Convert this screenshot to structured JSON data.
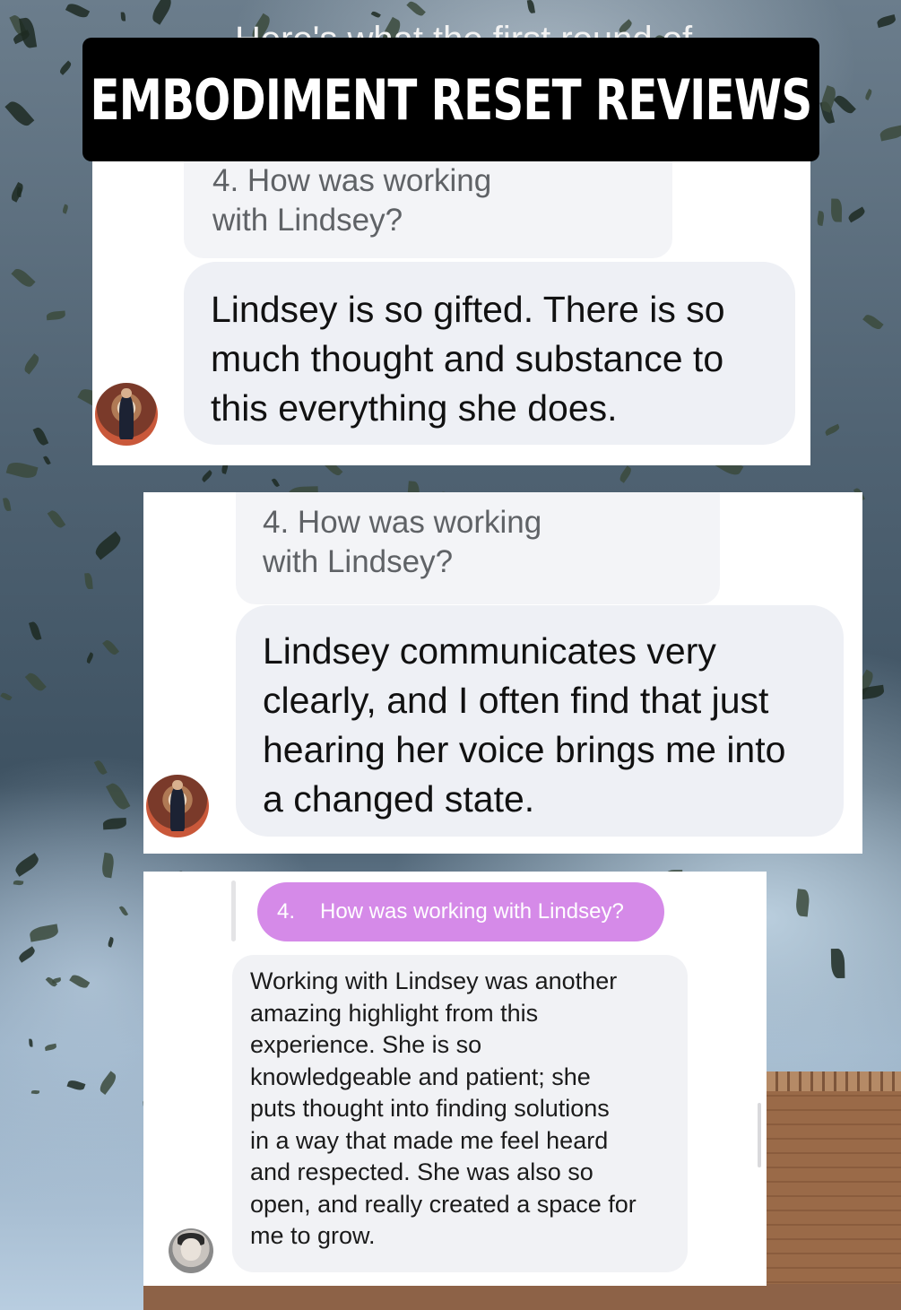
{
  "banner": {
    "title": "EMBODIMENT RESET REVIEWS",
    "partial_text_behind": "Here's what the first round of"
  },
  "reviews": [
    {
      "question": "4. How was working\nwith Lindsey?",
      "answer": "Lindsey is so gifted. There is so\nmuch thought and substance to\nthis everything she does."
    },
    {
      "question": "4. How was working\nwith Lindsey?",
      "answer": "Lindsey communicates very\nclearly, and I often find that just\nhearing her voice brings me into\na changed state."
    },
    {
      "question_number": "4.",
      "question_text": "How was working with Lindsey?",
      "answer": "Working with Lindsey was another\namazing highlight from this\nexperience. She is so\nknowledgeable and patient; she\nputs thought into finding solutions\nin a way that made me feel heard\nand respected. She was also so\nopen, and really created a space for\nme to grow."
    }
  ],
  "colors": {
    "banner_bg": "#000000",
    "banner_text": "#ffffff",
    "question_pill": "#d58ae8",
    "bubble_bg": "#eef0f5"
  }
}
